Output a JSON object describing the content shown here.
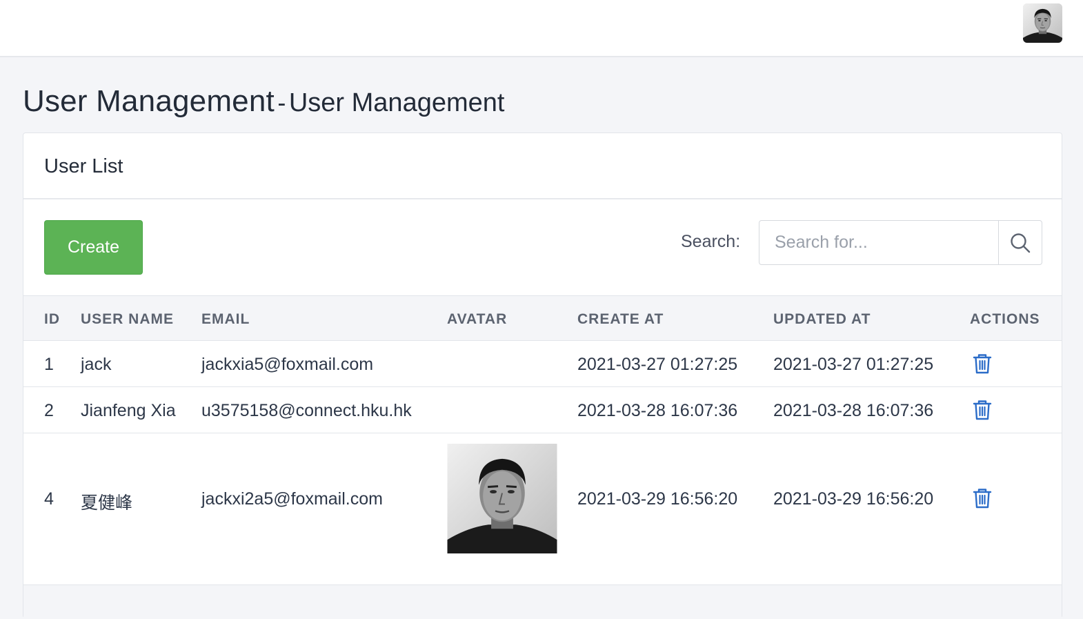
{
  "page": {
    "title": "User Management",
    "subtitle_separator": "-",
    "subtitle": "User Management"
  },
  "card": {
    "title": "User List"
  },
  "toolbar": {
    "create_label": "Create",
    "search_label": "Search:",
    "search_placeholder": "Search for...",
    "search_value": ""
  },
  "table": {
    "columns": [
      "ID",
      "USER NAME",
      "EMAIL",
      "AVATAR",
      "CREATE AT",
      "UPDATED AT",
      "ACTIONS"
    ],
    "rows": [
      {
        "id": "1",
        "username": "jack",
        "email": "jackxia5@foxmail.com",
        "avatar": "",
        "created_at": "2021-03-27 01:27:25",
        "updated_at": "2021-03-27 01:27:25",
        "action_icon": "trash-icon"
      },
      {
        "id": "2",
        "username": "Jianfeng Xia",
        "email": "u3575158@connect.hku.hk",
        "avatar": "",
        "created_at": "2021-03-28 16:07:36",
        "updated_at": "2021-03-28 16:07:36",
        "action_icon": "trash-icon"
      },
      {
        "id": "4",
        "username": "夏健峰",
        "email": "jackxi2a5@foxmail.com",
        "avatar": "user-photo",
        "created_at": "2021-03-29 16:56:20",
        "updated_at": "2021-03-29 16:56:20",
        "action_icon": "trash-icon"
      }
    ]
  },
  "colors": {
    "accent_green": "#5cb355",
    "action_blue": "#2b6cc8",
    "page_bg": "#f4f5f8"
  },
  "icons": {
    "search": "search-icon",
    "delete": "trash-icon",
    "user_avatar": "user-avatar-photo"
  }
}
